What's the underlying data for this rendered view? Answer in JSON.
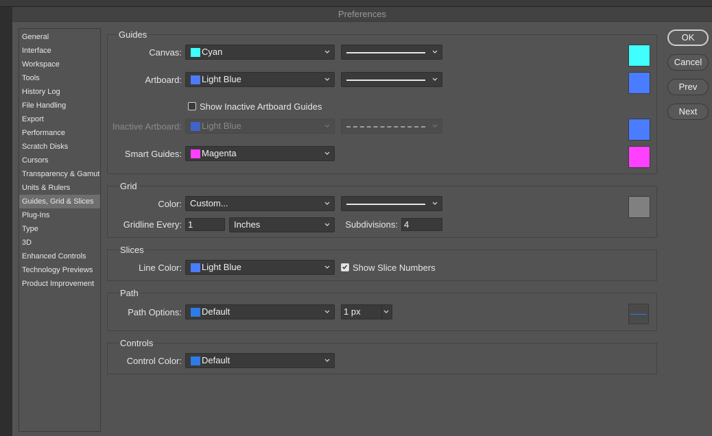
{
  "window": {
    "title": "Preferences"
  },
  "nav": {
    "items": [
      {
        "label": "General"
      },
      {
        "label": "Interface"
      },
      {
        "label": "Workspace"
      },
      {
        "label": "Tools"
      },
      {
        "label": "History Log"
      },
      {
        "label": "File Handling"
      },
      {
        "label": "Export"
      },
      {
        "label": "Performance"
      },
      {
        "label": "Scratch Disks"
      },
      {
        "label": "Cursors"
      },
      {
        "label": "Transparency & Gamut"
      },
      {
        "label": "Units & Rulers"
      },
      {
        "label": "Guides, Grid & Slices"
      },
      {
        "label": "Plug-Ins"
      },
      {
        "label": "Type"
      },
      {
        "label": "3D"
      },
      {
        "label": "Enhanced Controls"
      },
      {
        "label": "Technology Previews"
      },
      {
        "label": "Product Improvement"
      }
    ],
    "active": "Guides, Grid & Slices"
  },
  "buttons": {
    "ok": "OK",
    "cancel": "Cancel",
    "prev": "Prev",
    "next": "Next"
  },
  "guides": {
    "title": "Guides",
    "canvas_label": "Canvas:",
    "canvas_color": "Cyan",
    "canvas_hex": "#40ffff",
    "artboard_label": "Artboard:",
    "artboard_color": "Light Blue",
    "artboard_hex": "#4a7cff",
    "show_inactive_label": "Show Inactive Artboard Guides",
    "show_inactive_checked": false,
    "inactive_label": "Inactive Artboard:",
    "inactive_color": "Light Blue",
    "inactive_hex": "#4a7cff",
    "smart_label": "Smart Guides:",
    "smart_color": "Magenta",
    "smart_hex": "#ff40ff"
  },
  "grid": {
    "title": "Grid",
    "color_label": "Color:",
    "color_value": "Custom...",
    "color_hex": "#808080",
    "gridline_label": "Gridline Every:",
    "gridline_value": "1",
    "gridline_unit": "Inches",
    "subdivisions_label": "Subdivisions:",
    "subdivisions_value": "4"
  },
  "slices": {
    "title": "Slices",
    "line_color_label": "Line Color:",
    "line_color": "Light Blue",
    "line_hex": "#4a7cff",
    "show_numbers_label": "Show Slice Numbers",
    "show_numbers_checked": true
  },
  "path": {
    "title": "Path",
    "options_label": "Path Options:",
    "options_value": "Default",
    "options_hex": "#2e7be6",
    "width_value": "1 px"
  },
  "controls": {
    "title": "Controls",
    "color_label": "Control Color:",
    "color_value": "Default",
    "color_hex": "#2e7be6"
  }
}
